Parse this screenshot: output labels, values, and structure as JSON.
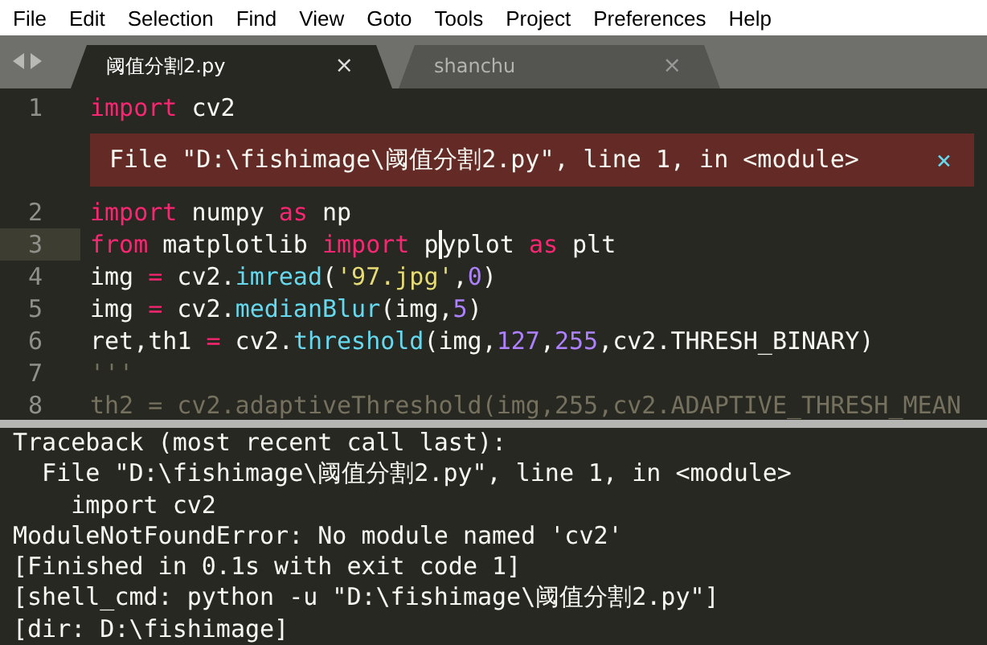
{
  "menu": [
    "File",
    "Edit",
    "Selection",
    "Find",
    "View",
    "Goto",
    "Tools",
    "Project",
    "Preferences",
    "Help"
  ],
  "tabs": [
    {
      "label": "阈值分割2.py",
      "selected": true,
      "close": "×"
    },
    {
      "label": "shanchu",
      "selected": false,
      "close": "×"
    }
  ],
  "editor": {
    "lines": [
      {
        "number": "1",
        "current": false,
        "tokens": [
          {
            "kind": "keyword",
            "text": "import"
          },
          {
            "kind": "plain",
            "text": " cv2"
          }
        ],
        "error": {
          "message": "File \"D:\\fishimage\\阈值分割2.py\", line 1, in <module>",
          "close": "×"
        }
      },
      {
        "number": "2",
        "current": false,
        "tokens": [
          {
            "kind": "keyword",
            "text": "import"
          },
          {
            "kind": "plain",
            "text": " numpy "
          },
          {
            "kind": "keyword",
            "text": "as"
          },
          {
            "kind": "plain",
            "text": " np"
          }
        ]
      },
      {
        "number": "3",
        "current": true,
        "tokens": [
          {
            "kind": "keyword",
            "text": "from"
          },
          {
            "kind": "plain",
            "text": " matplotlib "
          },
          {
            "kind": "keyword",
            "text": "import"
          },
          {
            "kind": "plain",
            "text": " p",
            "caret_after": true
          },
          {
            "kind": "plain",
            "text": "yplot "
          },
          {
            "kind": "keyword",
            "text": "as"
          },
          {
            "kind": "plain",
            "text": " plt"
          }
        ]
      },
      {
        "number": "4",
        "current": false,
        "tokens": [
          {
            "kind": "plain",
            "text": "img "
          },
          {
            "kind": "keyword",
            "text": "="
          },
          {
            "kind": "plain",
            "text": " cv2."
          },
          {
            "kind": "function",
            "text": "imread"
          },
          {
            "kind": "plain",
            "text": "("
          },
          {
            "kind": "string",
            "text": "'97.jpg'"
          },
          {
            "kind": "plain",
            "text": ","
          },
          {
            "kind": "number",
            "text": "0"
          },
          {
            "kind": "plain",
            "text": ")"
          }
        ]
      },
      {
        "number": "5",
        "current": false,
        "tokens": [
          {
            "kind": "plain",
            "text": "img "
          },
          {
            "kind": "keyword",
            "text": "="
          },
          {
            "kind": "plain",
            "text": " cv2."
          },
          {
            "kind": "function",
            "text": "medianBlur"
          },
          {
            "kind": "plain",
            "text": "(img,"
          },
          {
            "kind": "number",
            "text": "5"
          },
          {
            "kind": "plain",
            "text": ")"
          }
        ]
      },
      {
        "number": "6",
        "current": false,
        "tokens": [
          {
            "kind": "plain",
            "text": "ret,th1 "
          },
          {
            "kind": "keyword",
            "text": "="
          },
          {
            "kind": "plain",
            "text": " cv2."
          },
          {
            "kind": "function",
            "text": "threshold"
          },
          {
            "kind": "plain",
            "text": "(img,"
          },
          {
            "kind": "number",
            "text": "127"
          },
          {
            "kind": "plain",
            "text": ","
          },
          {
            "kind": "number",
            "text": "255"
          },
          {
            "kind": "plain",
            "text": ",cv2.THRESH_BINARY)"
          }
        ]
      },
      {
        "number": "7",
        "current": false,
        "tokens": [
          {
            "kind": "comment",
            "text": "'''"
          }
        ]
      },
      {
        "number": "8",
        "current": false,
        "tokens": [
          {
            "kind": "comment",
            "text": "th2 = cv2.adaptiveThreshold(img,255,cv2.ADAPTIVE_THRESH_MEAN"
          }
        ]
      }
    ]
  },
  "output": [
    "Traceback (most recent call last):",
    "  File \"D:\\fishimage\\阈值分割2.py\", line 1, in <module>",
    "    import cv2",
    "ModuleNotFoundError: No module named 'cv2'",
    "[Finished in 0.1s with exit code 1]",
    "[shell_cmd: python -u \"D:\\fishimage\\阈值分割2.py\"]",
    "[dir: D:\\fishimage]"
  ]
}
